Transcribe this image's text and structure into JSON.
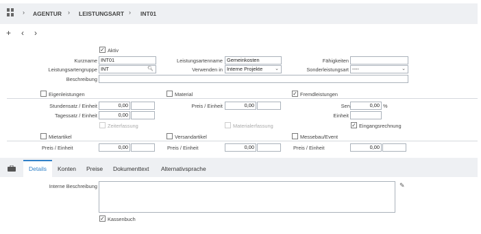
{
  "breadcrumb": {
    "items": [
      "AGENTUR",
      "LEISTUNGSART",
      "INT01"
    ]
  },
  "toolbar": {
    "add": "+",
    "back": "‹",
    "forward": "›"
  },
  "form": {
    "aktiv": {
      "label": "Aktiv",
      "checked": true
    },
    "kurzname": {
      "label": "Kurzname",
      "value": "INT01"
    },
    "leistungsartenname": {
      "label": "Leistungsartenname",
      "value": "Gemeinkosten"
    },
    "faehigkeiten": {
      "label": "Fähigkeiten",
      "value": ""
    },
    "leistungsartengruppe": {
      "label": "Leistungsartengruppe",
      "value": "INT"
    },
    "verwenden_in": {
      "label": "Verwenden in",
      "value": "Interne Projekte"
    },
    "sonderleistungsart": {
      "label": "Sonderleistungsart",
      "value": "----"
    },
    "beschreibung": {
      "label": "Beschreibung",
      "value": ""
    }
  },
  "sections": {
    "eigenleistungen": {
      "label": "Eigenleistungen",
      "checked": false
    },
    "material": {
      "label": "Material",
      "checked": false
    },
    "fremdleistungen": {
      "label": "Fremdleistungen",
      "checked": true
    },
    "mietartikel": {
      "label": "Mietartikel",
      "checked": false
    },
    "versandartikel": {
      "label": "Versandartikel",
      "checked": false
    },
    "messebau": {
      "label": "Messebau/Event",
      "checked": false
    }
  },
  "eigen": {
    "stundensatz_label": "Stundensatz / Einheit",
    "stundensatz": "0,00",
    "tagessatz_label": "Tagessatz / Einheit",
    "tagessatz": "0,00",
    "zeiterfassung": "Zeiterfassung"
  },
  "mat": {
    "preis_label": "Preis / Einheit",
    "preis": "0,00",
    "materialerfassung": "Materialerfassung"
  },
  "fremd": {
    "service_fee_label": "Service Fee",
    "service_fee": "0,00",
    "percent": "%",
    "einheit_label": "Einheit",
    "einheit": "",
    "eingangsrechnung": "Eingangsrechnung"
  },
  "miet": {
    "preis_label": "Preis / Einheit",
    "preis": "0,00"
  },
  "versand": {
    "preis_label": "Preis / Einheit",
    "preis": "0,00"
  },
  "messe": {
    "preis_label": "Preis / Einheit",
    "preis": "0,00"
  },
  "tabs": [
    "Details",
    "Konten",
    "Preise",
    "Dokumenttext",
    "Alternativsprache"
  ],
  "details": {
    "interne_beschreibung_label": "Interne Beschreibung",
    "interne_beschreibung": "",
    "kassenbuch": {
      "label": "Kassenbuch",
      "checked": true
    }
  },
  "colors": {
    "accent": "#2f80c8",
    "header_bg": "#eef0f3",
    "border": "#a9b1ba"
  }
}
